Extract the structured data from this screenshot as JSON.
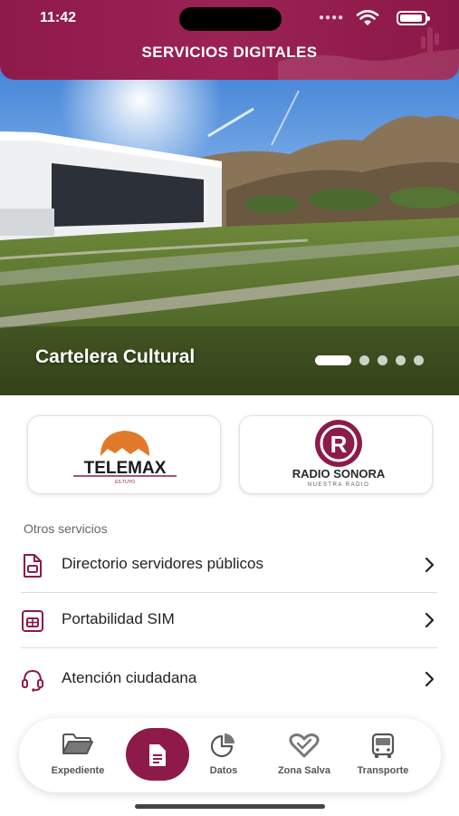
{
  "status_bar": {
    "time": "11:42"
  },
  "header": {
    "title": "SERVICIOS DIGITALES"
  },
  "hero": {
    "caption": "Cartelera Cultural",
    "slide_count": 5,
    "active_slide": 1
  },
  "partners": [
    {
      "name": "TELEMAX",
      "tagline": "ES TUYO"
    },
    {
      "name": "RADIO SONORA",
      "tagline": "NUESTRA RADIO",
      "monogram": "R"
    }
  ],
  "other_services": {
    "label": "Otros servicios",
    "items": [
      {
        "label": "Directorio servidores públicos",
        "icon": "document-icon"
      },
      {
        "label": "Portabilidad SIM",
        "icon": "sim-card-icon"
      },
      {
        "label": "Atención ciudadana",
        "icon": "headset-icon"
      }
    ]
  },
  "bottom_nav": {
    "items": [
      {
        "label": "Expediente",
        "icon": "folder-icon"
      },
      {
        "label": "",
        "icon": "document-icon",
        "active": true
      },
      {
        "label": "Datos",
        "icon": "pie-chart-icon"
      },
      {
        "label": "Zona Salva",
        "icon": "heart-icon"
      },
      {
        "label": "Transporte",
        "icon": "bus-icon"
      }
    ]
  },
  "colors": {
    "brand": "#8e1a4a",
    "telemax_orange": "#e07a2a",
    "radio_maroon": "#8e1a4a"
  }
}
